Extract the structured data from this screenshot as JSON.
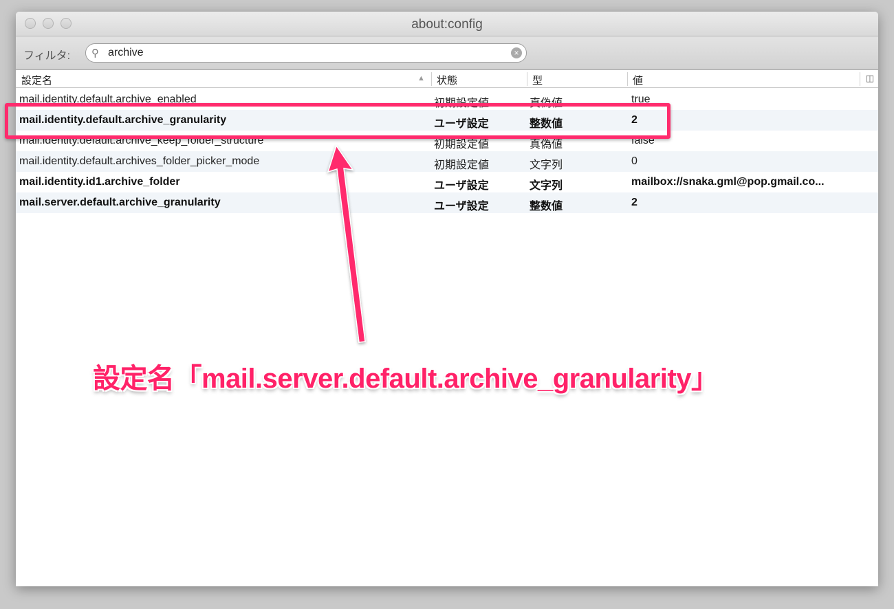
{
  "window": {
    "title": "about:config"
  },
  "toolbar": {
    "filter_label": "フィルタ:",
    "search_value": "archive",
    "search_icon": "magnifier-icon",
    "clear_icon": "clear-icon"
  },
  "columns": {
    "name": "設定名",
    "status": "状態",
    "type": "型",
    "value": "値",
    "picker_icon": "column-picker-icon"
  },
  "rows": [
    {
      "name": "mail.identity.default.archive_enabled",
      "status": "初期設定値",
      "type": "真偽値",
      "value": "true",
      "user": false
    },
    {
      "name": "mail.identity.default.archive_granularity",
      "status": "ユーザ設定",
      "type": "整数値",
      "value": "2",
      "user": true
    },
    {
      "name": "mail.identity.default.archive_keep_folder_structure",
      "status": "初期設定値",
      "type": "真偽値",
      "value": "false",
      "user": false
    },
    {
      "name": "mail.identity.default.archives_folder_picker_mode",
      "status": "初期設定値",
      "type": "文字列",
      "value": "0",
      "user": false
    },
    {
      "name": "mail.identity.id1.archive_folder",
      "status": "ユーザ設定",
      "type": "文字列",
      "value": "mailbox://snaka.gml@pop.gmail.co...",
      "user": true
    },
    {
      "name": "mail.server.default.archive_granularity",
      "status": "ユーザ設定",
      "type": "整数値",
      "value": "2",
      "user": true
    }
  ],
  "annotation": {
    "text": "設定名「mail.server.default.archive_granularity」",
    "color": "#ff2268"
  }
}
